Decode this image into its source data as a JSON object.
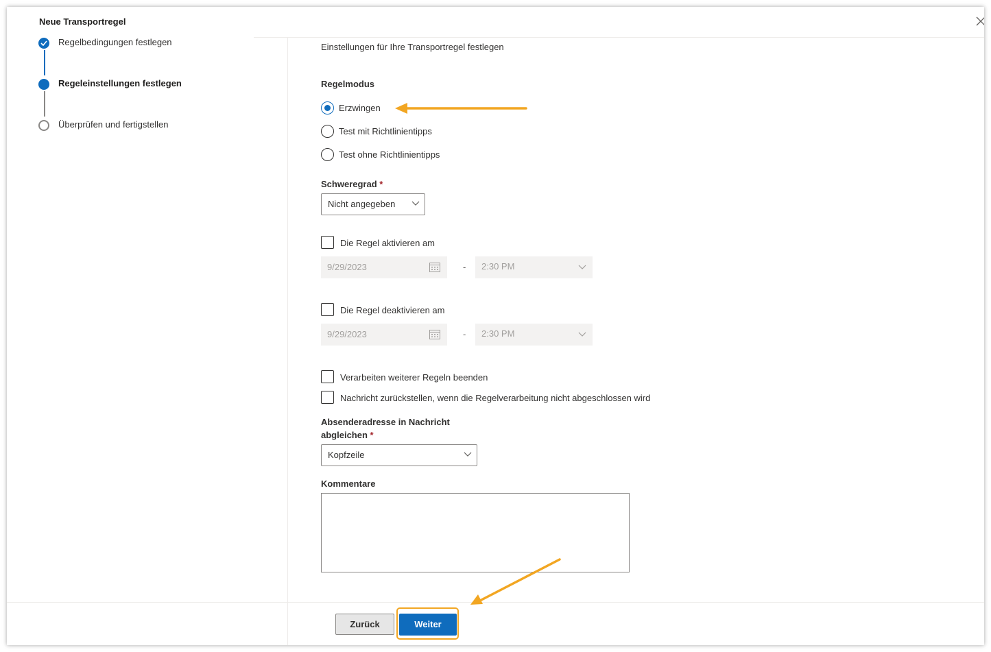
{
  "header": {
    "title": "Neue Transportregel",
    "close_icon": "close-icon"
  },
  "steps": [
    {
      "label": "Regelbedingungen festlegen",
      "state": "completed"
    },
    {
      "label": "Regeleinstellungen festlegen",
      "state": "current"
    },
    {
      "label": "Überprüfen und fertigstellen",
      "state": "pending"
    }
  ],
  "main": {
    "intro": "Einstellungen für Ihre Transportregel festlegen",
    "rule_mode": {
      "label": "Regelmodus",
      "options": [
        "Erzwingen",
        "Test mit Richtlinientipps",
        "Test ohne Richtlinientipps"
      ],
      "selected": "Erzwingen"
    },
    "severity": {
      "label": "Schweregrad",
      "required_mark": "*",
      "value": "Nicht angegeben"
    },
    "activate": {
      "label": "Die Regel aktivieren am",
      "date": "9/29/2023",
      "separator": "-",
      "time": "2:30 PM"
    },
    "deactivate": {
      "label": "Die Regel deaktivieren am",
      "date": "9/29/2023",
      "separator": "-",
      "time": "2:30 PM"
    },
    "stop_processing": {
      "label": "Verarbeiten weiterer Regeln beenden"
    },
    "defer_message": {
      "label": "Nachricht zurückstellen, wenn die Regelverarbeitung nicht abgeschlossen wird"
    },
    "sender_address": {
      "label_line1": "Absenderadresse in Nachricht",
      "label_line2": "abgleichen",
      "required_mark": "*",
      "value": "Kopfzeile"
    },
    "comments": {
      "label": "Kommentare",
      "value": ""
    }
  },
  "footer": {
    "back_label": "Zurück",
    "next_label": "Weiter"
  },
  "colors": {
    "accent": "#0f6cbd",
    "annotation": "#f2a622"
  }
}
